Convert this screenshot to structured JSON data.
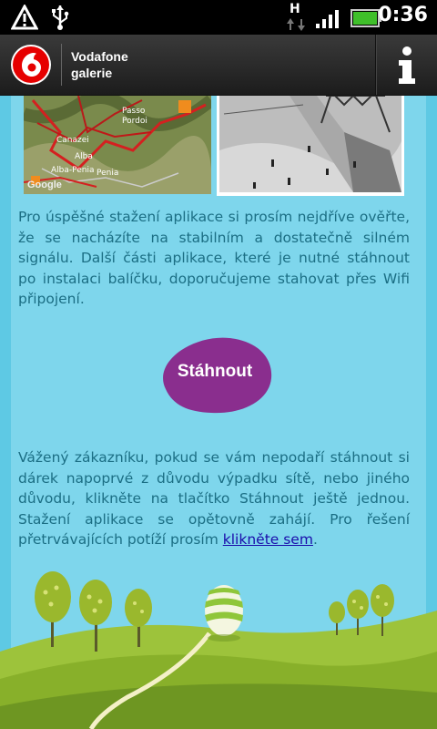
{
  "status_bar": {
    "time": "0:36",
    "network_type": "H",
    "icons": [
      "warning-icon",
      "usb-icon",
      "network-activity-icon",
      "signal-icon",
      "battery-icon"
    ]
  },
  "title_bar": {
    "title_line1": "Vodafone",
    "title_line2": "galerie",
    "info_icon": "info-icon"
  },
  "images": {
    "map_labels": [
      "Passo",
      "Pordoi",
      "Canazei",
      "Alba",
      "Alba-Penia",
      "Penia",
      "Google"
    ]
  },
  "content": {
    "paragraph1": "Pro úspěšné stažení aplikace si prosím nejdříve ověřte, že se nacházíte na stabilním a dostatečně silném signálu. Další části aplikace, které je nutné stáhnout po instalaci balíčku, doporučujeme stahovat přes Wifi připojení.",
    "download_button": "Stáhnout",
    "paragraph2": "Vážený zákazníku, pokud se vám nepodaří stáhnout si dárek napoprvé z důvodu výpadku sítě, nebo jiného důvodu, klikněte na tlačítko Stáhnout ještě jednou. Stažení aplikace se opětovně zahájí. Pro řešení přetrvávajících potíží prosím",
    "link_text": "klikněte sem",
    "paragraph2_end": "."
  },
  "colors": {
    "background": "#7ed6ec",
    "text": "#1b6e84",
    "button": "#8a2e8e",
    "link": "#1a0dab"
  }
}
